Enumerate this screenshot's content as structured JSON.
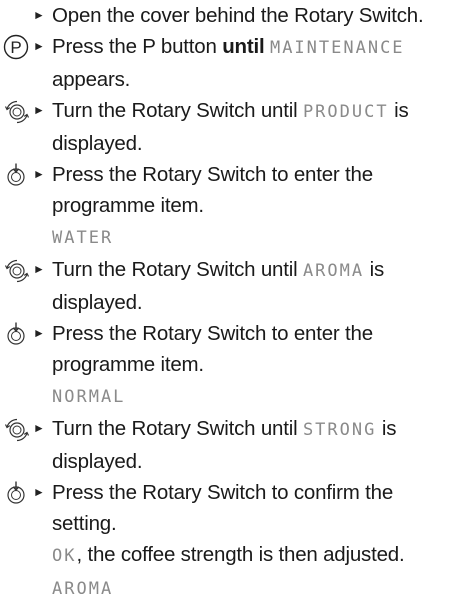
{
  "steps": [
    {
      "icon": "none",
      "lines": [
        {
          "parts": [
            {
              "t": "Open the cover behind the Rotary Switch."
            }
          ]
        }
      ]
    },
    {
      "icon": "p-button-icon",
      "lines": [
        {
          "parts": [
            {
              "t": "Press the P button "
            },
            {
              "t": "until",
              "s": "bold"
            },
            {
              "t": " "
            },
            {
              "t": "MAINTENANCE",
              "s": "disp"
            }
          ]
        },
        {
          "parts": [
            {
              "t": "appears."
            }
          ]
        }
      ]
    },
    {
      "icon": "rotary-turn-icon",
      "lines": [
        {
          "parts": [
            {
              "t": "Turn the Rotary Switch until "
            },
            {
              "t": "PRODUCT",
              "s": "disp"
            },
            {
              "t": " is"
            }
          ]
        },
        {
          "parts": [
            {
              "t": "displayed."
            }
          ]
        }
      ]
    },
    {
      "icon": "rotary-press-icon",
      "lines": [
        {
          "parts": [
            {
              "t": "Press the Rotary Switch to enter the"
            }
          ]
        },
        {
          "parts": [
            {
              "t": "programme item."
            }
          ]
        },
        {
          "parts": [
            {
              "t": "WATER",
              "s": "disp"
            }
          ]
        }
      ]
    },
    {
      "icon": "rotary-turn-icon",
      "lines": [
        {
          "parts": [
            {
              "t": "Turn the Rotary Switch until "
            },
            {
              "t": "AROMA",
              "s": "disp"
            },
            {
              "t": " is"
            }
          ]
        },
        {
          "parts": [
            {
              "t": "displayed."
            }
          ]
        }
      ]
    },
    {
      "icon": "rotary-press-icon",
      "lines": [
        {
          "parts": [
            {
              "t": "Press the Rotary Switch to enter the"
            }
          ]
        },
        {
          "parts": [
            {
              "t": "programme item."
            }
          ]
        },
        {
          "parts": [
            {
              "t": "NORMAL",
              "s": "disp"
            }
          ]
        }
      ]
    },
    {
      "icon": "rotary-turn-icon",
      "lines": [
        {
          "parts": [
            {
              "t": "Turn the Rotary Switch until "
            },
            {
              "t": "STRONG",
              "s": "disp"
            },
            {
              "t": " is"
            }
          ]
        },
        {
          "parts": [
            {
              "t": "displayed."
            }
          ]
        }
      ]
    },
    {
      "icon": "rotary-press-icon",
      "lines": [
        {
          "parts": [
            {
              "t": "Press the Rotary Switch to confirm the"
            }
          ]
        },
        {
          "parts": [
            {
              "t": "setting."
            }
          ]
        },
        {
          "parts": [
            {
              "t": "OK",
              "s": "disp"
            },
            {
              "t": ", the coffee strength is then adjusted."
            }
          ]
        },
        {
          "parts": [
            {
              "t": "AROMA",
              "s": "disp"
            }
          ]
        }
      ]
    }
  ],
  "bullet_glyph": "►",
  "p_button_letter": "P"
}
